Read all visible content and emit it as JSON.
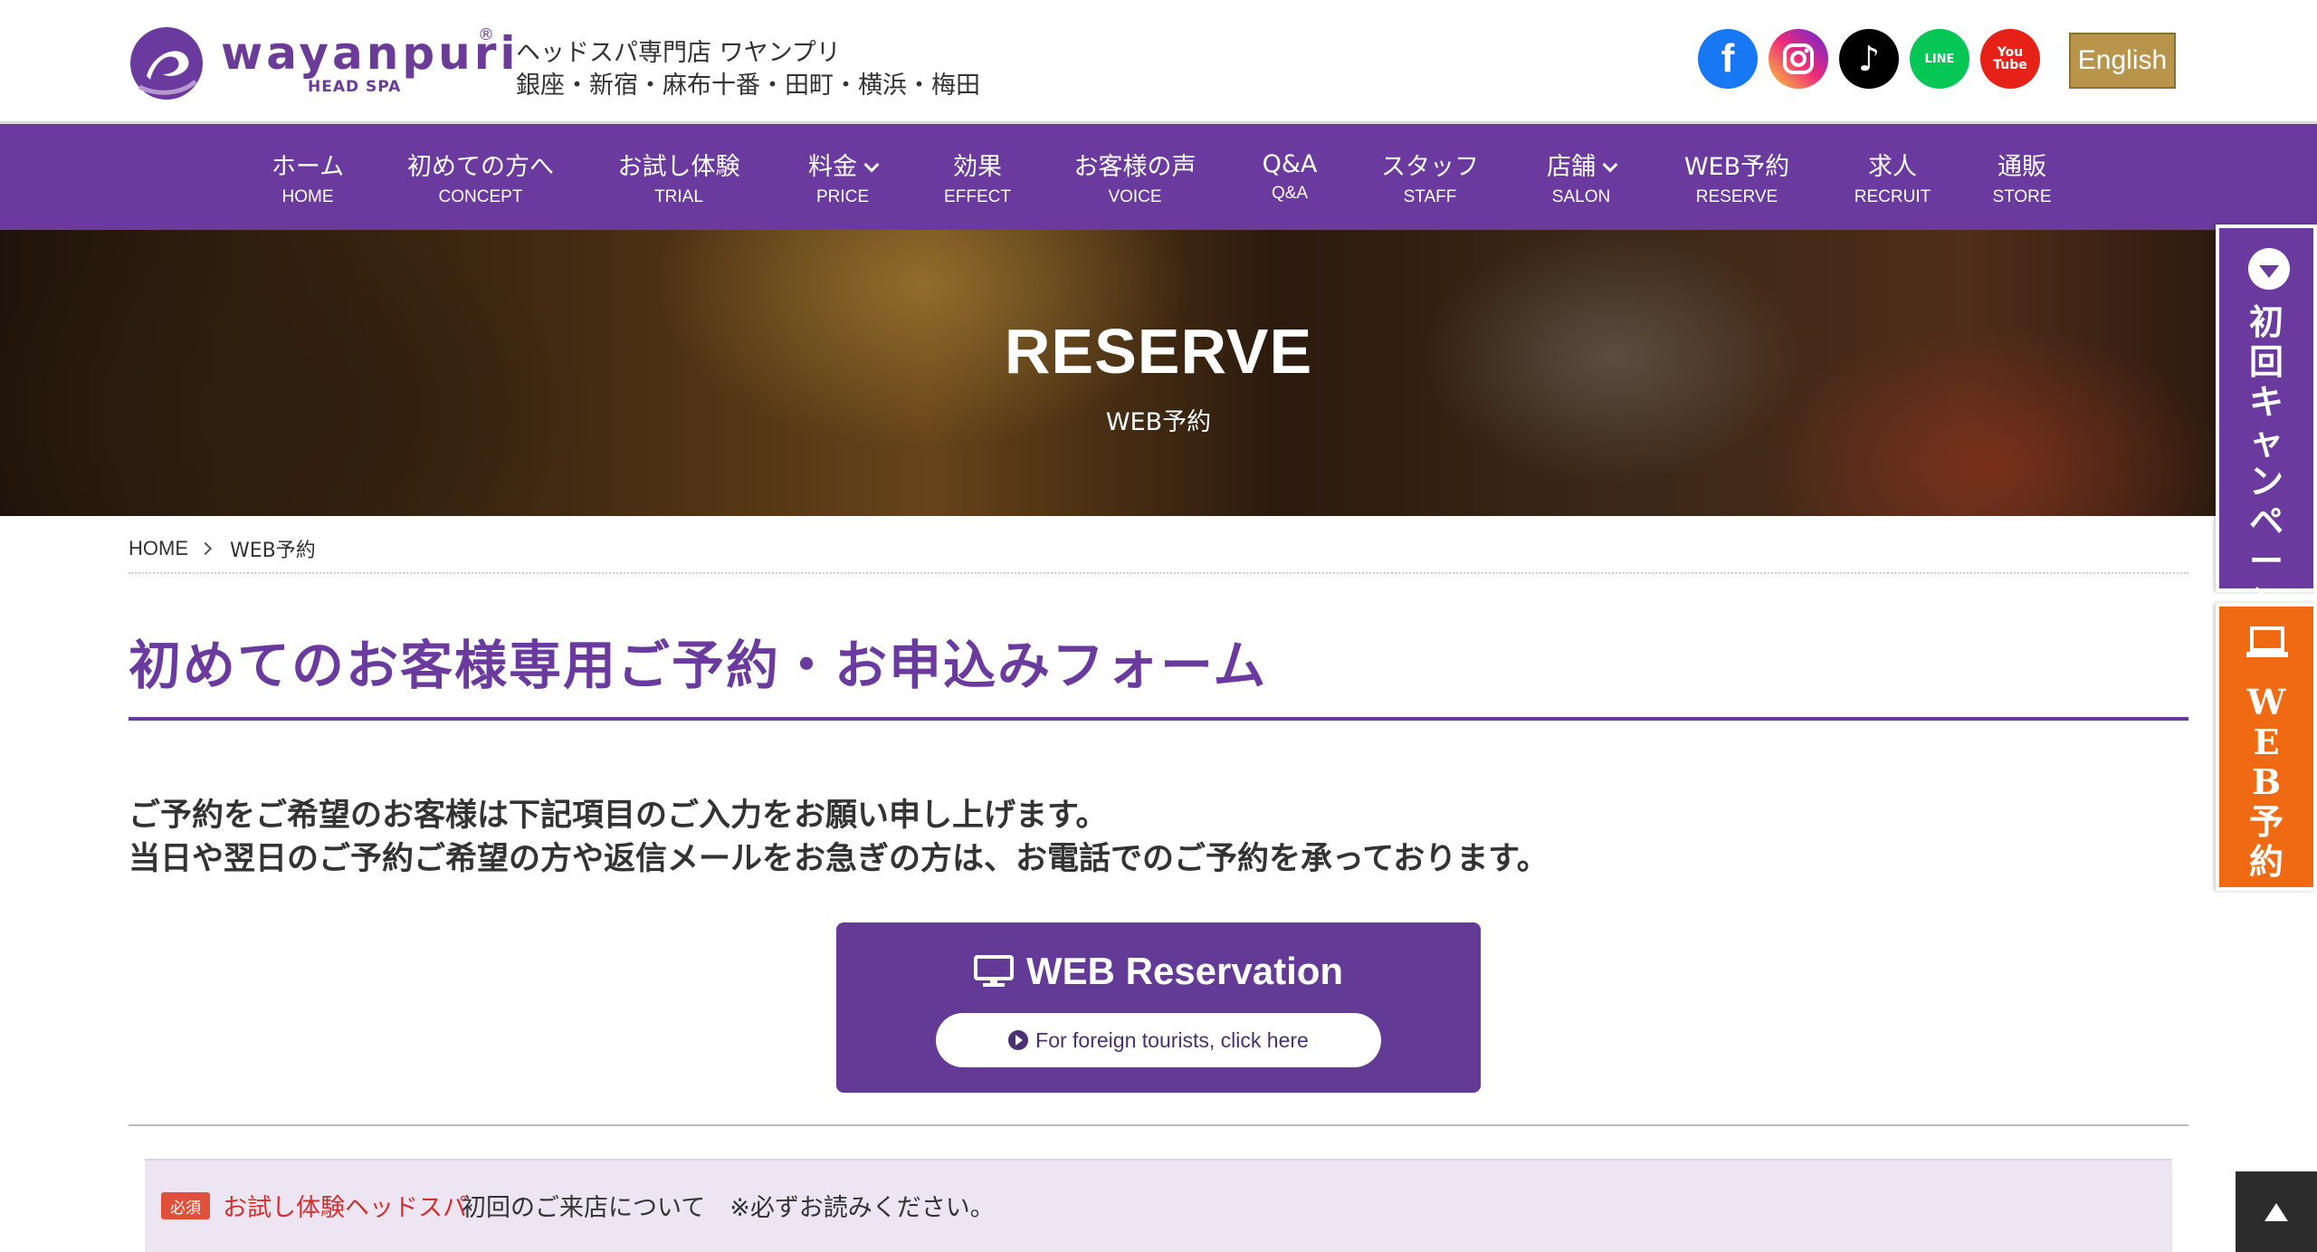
{
  "header": {
    "logo_word": "wayanpuri",
    "logo_reg": "®",
    "logo_sub": "HEAD SPA",
    "tagline1": "ヘッドスパ専門店 ワヤンプリ",
    "tagline2": "銀座・新宿・麻布十番・田町・横浜・梅田",
    "social": [
      "facebook-icon",
      "instagram-icon",
      "tiktok-icon",
      "line-icon",
      "youtube-icon"
    ],
    "line_label": "LINE",
    "youtube_label": "You Tube",
    "english_label": "English"
  },
  "nav": {
    "items": [
      {
        "jp": "ホーム",
        "en": "HOME"
      },
      {
        "jp": "初めての方へ",
        "en": "CONCEPT"
      },
      {
        "jp": "お試し体験",
        "en": "TRIAL"
      },
      {
        "jp": "料金",
        "en": "PRICE"
      },
      {
        "jp": "効果",
        "en": "EFFECT"
      },
      {
        "jp": "お客様の声",
        "en": "VOICE"
      },
      {
        "jp": "Q&A",
        "en": "Q&A"
      },
      {
        "jp": "スタッフ",
        "en": "STAFF"
      },
      {
        "jp": "店舗",
        "en": "SALON"
      },
      {
        "jp": "WEB予約",
        "en": "RESERVE"
      },
      {
        "jp": "求人",
        "en": "RECRUIT"
      },
      {
        "jp": "通販",
        "en": "STORE"
      }
    ]
  },
  "hero": {
    "title": "RESERVE",
    "subtitle": "WEB予約"
  },
  "side": {
    "campaign": "初回キャンペーン",
    "web": "WEB予約"
  },
  "breadcrumb": {
    "home": "HOME",
    "current": "WEB予約"
  },
  "main": {
    "title": "初めてのお客様専用ご予約・お申込みフォーム",
    "intro1": "ご予約をご希望のお客様は下記項目のご入力をお願い申し上げます。",
    "intro2": "当日や翌日のご予約ご希望の方や返信メールをお急ぎの方は、お電話でのご予約を承っております。",
    "web_reservation": "WEB Reservation",
    "foreign_link": "For foreign tourists, click here"
  },
  "notice": {
    "badge": "必須",
    "red_text": "お試し体験ヘッドスパ",
    "rest": "初回のご来店について　※必ずお読みください。"
  },
  "colors": {
    "brand_purple": "#6b3a9e",
    "accent_orange": "#f06a14",
    "english_gold": "#b8954a"
  }
}
